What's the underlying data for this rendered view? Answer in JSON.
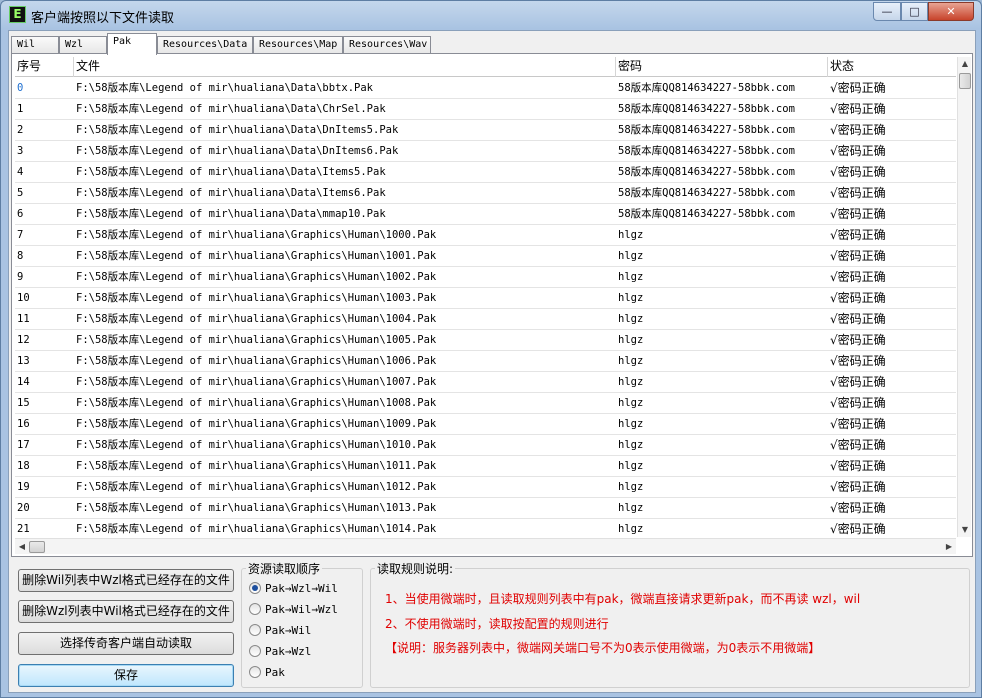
{
  "window": {
    "title": "客户端按照以下文件读取",
    "icon": "E",
    "min": "—",
    "max": "□",
    "close": "✕"
  },
  "tabs": [
    "Wil",
    "Wzl",
    "Pak",
    "Resources\\Data",
    "Resources\\Map",
    "Resources\\Wav"
  ],
  "table": {
    "headers": [
      "序号",
      "文件",
      "密码",
      "状态"
    ],
    "rows": [
      [
        "0",
        "F:\\58版本库\\Legend of mir\\hualiana\\Data\\bbtx.Pak",
        "58版本库QQ814634227-58bbk.com",
        "√密码正确"
      ],
      [
        "1",
        "F:\\58版本库\\Legend of mir\\hualiana\\Data\\ChrSel.Pak",
        "58版本库QQ814634227-58bbk.com",
        "√密码正确"
      ],
      [
        "2",
        "F:\\58版本库\\Legend of mir\\hualiana\\Data\\DnItems5.Pak",
        "58版本库QQ814634227-58bbk.com",
        "√密码正确"
      ],
      [
        "3",
        "F:\\58版本库\\Legend of mir\\hualiana\\Data\\DnItems6.Pak",
        "58版本库QQ814634227-58bbk.com",
        "√密码正确"
      ],
      [
        "4",
        "F:\\58版本库\\Legend of mir\\hualiana\\Data\\Items5.Pak",
        "58版本库QQ814634227-58bbk.com",
        "√密码正确"
      ],
      [
        "5",
        "F:\\58版本库\\Legend of mir\\hualiana\\Data\\Items6.Pak",
        "58版本库QQ814634227-58bbk.com",
        "√密码正确"
      ],
      [
        "6",
        "F:\\58版本库\\Legend of mir\\hualiana\\Data\\mmap10.Pak",
        "58版本库QQ814634227-58bbk.com",
        "√密码正确"
      ],
      [
        "7",
        "F:\\58版本库\\Legend of mir\\hualiana\\Graphics\\Human\\1000.Pak",
        "hlgz",
        "√密码正确"
      ],
      [
        "8",
        "F:\\58版本库\\Legend of mir\\hualiana\\Graphics\\Human\\1001.Pak",
        "hlgz",
        "√密码正确"
      ],
      [
        "9",
        "F:\\58版本库\\Legend of mir\\hualiana\\Graphics\\Human\\1002.Pak",
        "hlgz",
        "√密码正确"
      ],
      [
        "10",
        "F:\\58版本库\\Legend of mir\\hualiana\\Graphics\\Human\\1003.Pak",
        "hlgz",
        "√密码正确"
      ],
      [
        "11",
        "F:\\58版本库\\Legend of mir\\hualiana\\Graphics\\Human\\1004.Pak",
        "hlgz",
        "√密码正确"
      ],
      [
        "12",
        "F:\\58版本库\\Legend of mir\\hualiana\\Graphics\\Human\\1005.Pak",
        "hlgz",
        "√密码正确"
      ],
      [
        "13",
        "F:\\58版本库\\Legend of mir\\hualiana\\Graphics\\Human\\1006.Pak",
        "hlgz",
        "√密码正确"
      ],
      [
        "14",
        "F:\\58版本库\\Legend of mir\\hualiana\\Graphics\\Human\\1007.Pak",
        "hlgz",
        "√密码正确"
      ],
      [
        "15",
        "F:\\58版本库\\Legend of mir\\hualiana\\Graphics\\Human\\1008.Pak",
        "hlgz",
        "√密码正确"
      ],
      [
        "16",
        "F:\\58版本库\\Legend of mir\\hualiana\\Graphics\\Human\\1009.Pak",
        "hlgz",
        "√密码正确"
      ],
      [
        "17",
        "F:\\58版本库\\Legend of mir\\hualiana\\Graphics\\Human\\1010.Pak",
        "hlgz",
        "√密码正确"
      ],
      [
        "18",
        "F:\\58版本库\\Legend of mir\\hualiana\\Graphics\\Human\\1011.Pak",
        "hlgz",
        "√密码正确"
      ],
      [
        "19",
        "F:\\58版本库\\Legend of mir\\hualiana\\Graphics\\Human\\1012.Pak",
        "hlgz",
        "√密码正确"
      ],
      [
        "20",
        "F:\\58版本库\\Legend of mir\\hualiana\\Graphics\\Human\\1013.Pak",
        "hlgz",
        "√密码正确"
      ],
      [
        "21",
        "F:\\58版本库\\Legend of mir\\hualiana\\Graphics\\Human\\1014.Pak",
        "hlgz",
        "√密码正确"
      ]
    ]
  },
  "buttons": {
    "delete_wil": "删除Wil列表中Wzl格式已经存在的文件",
    "delete_wzl": "删除Wzl列表中Wil格式已经存在的文件",
    "select_client": "选择传奇客户端自动读取",
    "save": "保存"
  },
  "order": {
    "label": "资源读取顺序",
    "options": [
      "Pak→Wzl→Wil",
      "Pak→Wil→Wzl",
      "Pak→Wil",
      "Pak→Wzl",
      "Pak"
    ],
    "selected": 0
  },
  "rules": {
    "label": "读取规则说明:",
    "line1": "1、当使用微端时，且读取规则列表中有pak，微端直接请求更新pak，而不再读 wzl，wil",
    "line2": "2、不使用微端时，读取按配置的规则进行",
    "line3": "【说明：服务器列表中，微端网关端口号不为0表示使用微端，为0表示不用微端】"
  },
  "colors": {
    "rules_text": "#e00000",
    "selected_index": "#1e6fd0"
  }
}
